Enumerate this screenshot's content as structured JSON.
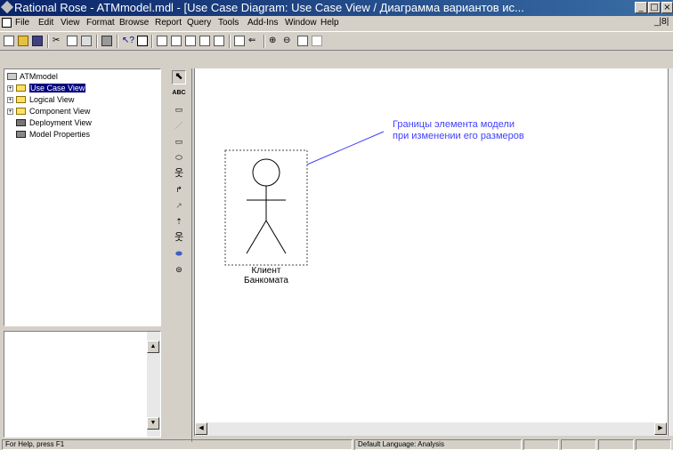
{
  "window": {
    "title": "Rational Rose - ATMmodel.mdl - [Use Case Diagram: Use Case View / Диаграмма вариантов ис..."
  },
  "menu": [
    "File",
    "Edit",
    "View",
    "Format",
    "Browse",
    "Report",
    "Query",
    "Tools",
    "Add-Ins",
    "Window",
    "Help"
  ],
  "browser": {
    "items": [
      {
        "label": "ATMmodel"
      },
      {
        "label": "Use Case View"
      },
      {
        "label": "Logical View"
      },
      {
        "label": "Component View"
      },
      {
        "label": "Deployment View"
      },
      {
        "label": "Model Properties"
      }
    ]
  },
  "toolbox": {
    "abc_label": "ABC"
  },
  "diagram": {
    "annotation_line1": "Границы элемента модели",
    "annotation_line2": "при изменении его размеров",
    "actor_name_line1": "Клиент",
    "actor_name_line2": "Банкомата",
    "annotation_color": "#4040ff"
  },
  "status": {
    "help": "For Help, press F1",
    "language": "Default Language: Analysis"
  }
}
